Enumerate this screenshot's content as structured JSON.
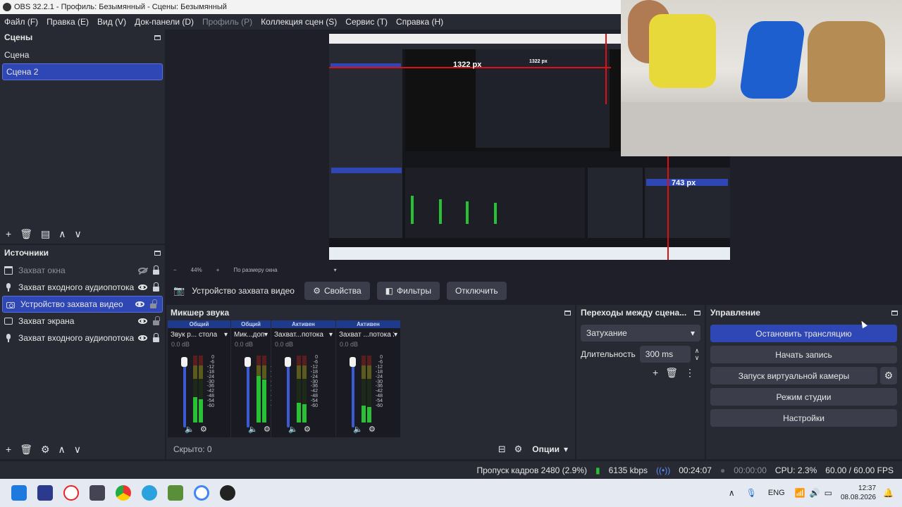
{
  "window": {
    "title": "OBS 32.2.1 - Профиль: Безымянный - Сцены: Безымянный"
  },
  "menu": [
    "Файл (F)",
    "Правка (E)",
    "Вид (V)",
    "Док-панели (D)",
    "Профиль (P)",
    "Коллекция сцен (S)",
    "Сервис (T)",
    "Справка (H)"
  ],
  "scenes": {
    "title": "Сцены",
    "items": [
      "Сцена",
      "Сцена 2"
    ],
    "selected": 1
  },
  "sources": {
    "title": "Источники",
    "items": [
      {
        "label": "Захват окна",
        "icon": "window-icon",
        "visible": false,
        "locked": true
      },
      {
        "label": "Захват входного аудиопотока",
        "icon": "mic-icon",
        "visible": true,
        "locked": true
      },
      {
        "label": "Устройство захвата видео",
        "icon": "camera-icon",
        "visible": true,
        "locked": false,
        "selected": true
      },
      {
        "label": "Захват экрана",
        "icon": "screen-icon",
        "visible": true,
        "locked": false
      },
      {
        "label": "Захват входного аудиопотока",
        "icon": "mic-icon",
        "visible": true,
        "locked": true
      }
    ]
  },
  "preview": {
    "overlay_w": "1322 px",
    "overlay_h": "743 px",
    "nested_w": "1322 px",
    "zoom": "44%",
    "fit": "По размеру окна",
    "minus": "−",
    "plus": "+"
  },
  "source_bar": {
    "name": "Устройство захвата видео",
    "properties": "Свойства",
    "filters": "Фильтры",
    "deactivate": "Отключить"
  },
  "mixer": {
    "title": "Микшер звука",
    "hidden": "Скрыто: 0",
    "options": "Опции",
    "channels": [
      {
        "tag": "Общий",
        "name": "Звук р... стола",
        "db": "0.0 dB",
        "level": 0.38
      },
      {
        "tag": "Общий",
        "name": "Мик...доп",
        "db": "0.0 dB",
        "level": 0.7
      },
      {
        "tag": "Активен",
        "name": "Захват...потока",
        "db": "0.0 dB",
        "level": 0.3
      },
      {
        "tag": "Активен",
        "name": "Захват ...потока 2",
        "db": "0.0 dB",
        "level": 0.25
      }
    ],
    "ticks": [
      "0",
      "-6",
      "-12",
      "-18",
      "-24",
      "-30",
      "-36",
      "-42",
      "-48",
      "-54",
      "-60"
    ]
  },
  "transitions": {
    "title": "Переходы между сцена...",
    "selected": "Затухание",
    "duration_label": "Длительность",
    "duration": "300 ms"
  },
  "controls": {
    "title": "Управление",
    "stop_stream": "Остановить трансляцию",
    "start_record": "Начать запись",
    "virtual_cam": "Запуск виртуальной камеры",
    "studio_mode": "Режим студии",
    "settings": "Настройки"
  },
  "status": {
    "dropped": "Пропуск кадров 2480 (2.9%)",
    "bitrate": "6135 kbps",
    "stream_time": "00:24:07",
    "record_time": "00:00:00",
    "cpu": "CPU: 2.3%",
    "fps": "60.00 / 60.00 FPS"
  },
  "taskbar": {
    "lang": "ENG",
    "time": "12:37",
    "date": "08.08.2026"
  },
  "colors": {
    "accent": "#2f47b5",
    "meter_green": "#2ac035",
    "panel": "#272a33",
    "bg": "#1e1f29"
  }
}
